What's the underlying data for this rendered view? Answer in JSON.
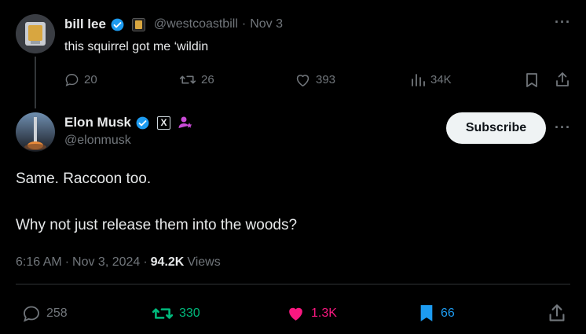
{
  "quoted_tweet": {
    "display_name": "bill lee",
    "handle": "@westcoastbill",
    "separator": "·",
    "date": "Nov 3",
    "text": "this squirrel got me ‘wildin",
    "replies": "20",
    "reposts": "26",
    "likes": "393",
    "views": "34K"
  },
  "main_tweet": {
    "display_name": "Elon Musk",
    "handle": "@elonmusk",
    "subscribe_label": "Subscribe",
    "line1": "Same. Raccoon too.",
    "line2": "Why not just release them into the woods?",
    "time": "6:16 AM",
    "dot1": "·",
    "date": "Nov 3, 2024",
    "dot2": "·",
    "views_count": "94.2K",
    "views_label": "Views",
    "replies": "258",
    "reposts": "330",
    "likes": "1.3K",
    "bookmarks": "66",
    "x_badge": "X"
  },
  "colors": {
    "verified": "#1d9bf0",
    "repost_active": "#00ba7c",
    "like_active": "#f91880",
    "bookmark_active": "#1d9bf0",
    "muted": "#71767b"
  },
  "icons": [
    "verified-badge-icon",
    "gold-badge-icon",
    "reply-icon",
    "repost-icon",
    "like-icon",
    "views-icon",
    "bookmark-icon",
    "share-icon",
    "more-icon",
    "x-affiliation-icon",
    "profile-badge-icon"
  ]
}
